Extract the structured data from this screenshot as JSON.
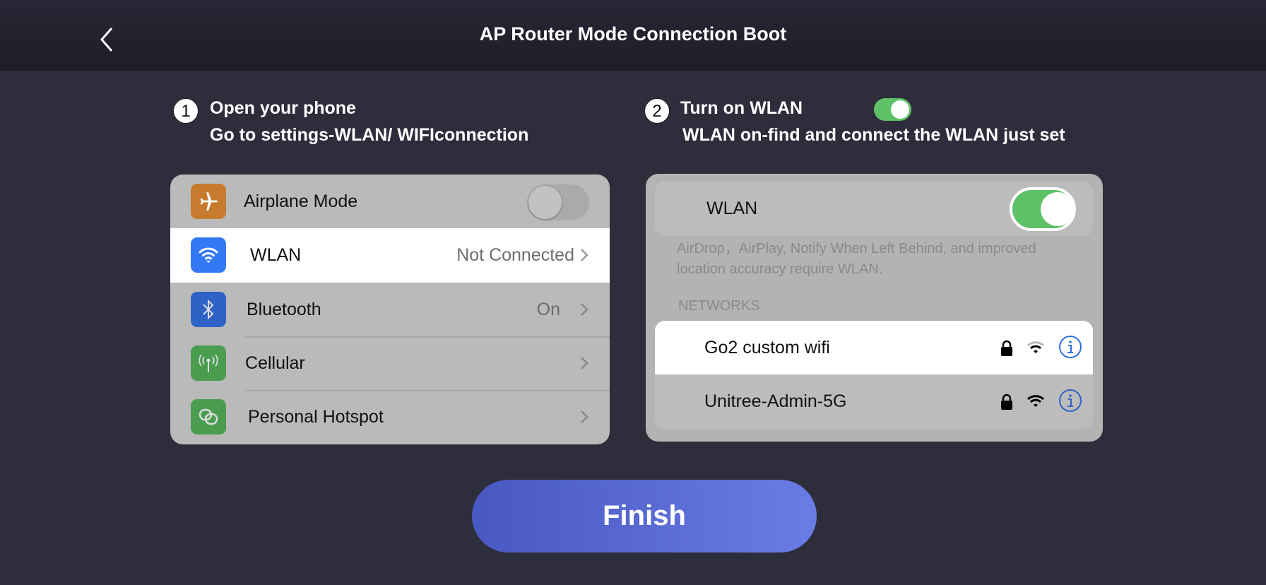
{
  "header": {
    "title": "AP Router Mode Connection Boot",
    "back_icon": "chevron-left-icon"
  },
  "step1": {
    "number": "1",
    "line1": "Open your phone",
    "line2": "Go to settings-WLAN/ WIFIconnection"
  },
  "step2": {
    "number": "2",
    "line1": "Turn on WLAN",
    "line2": "WLAN on-find and connect the WLAN just set",
    "toggle_on": true
  },
  "settings": {
    "items": [
      {
        "label": "Airplane Mode",
        "icon": "airplane-icon",
        "color": "#c77b2e",
        "toggle_on": false
      },
      {
        "label": "WLAN",
        "value": "Not Connected",
        "icon": "wifi-icon",
        "color": "#3478f6",
        "highlighted": true
      },
      {
        "label": "Bluetooth",
        "value": "On",
        "icon": "bluetooth-icon",
        "color": "#2f62c6"
      },
      {
        "label": "Cellular",
        "icon": "antenna-icon",
        "color": "#4a9d4f"
      },
      {
        "label": "Personal Hotspot",
        "icon": "hotspot-icon",
        "color": "#4a9d4f"
      }
    ]
  },
  "wlan": {
    "label": "WLAN",
    "toggle_on": true,
    "note": "AirDrop，AirPlay, Notify When Left Behind, and improved location accuracy require WLAN.",
    "networks_header": "NETWORKS",
    "networks": [
      {
        "name": "Go2 custom wifi",
        "highlighted": true
      },
      {
        "name": "Unitree-Admin-5G"
      }
    ]
  },
  "finish_label": "Finish",
  "colors": {
    "accent": "#5a6bd6",
    "toggle_green": "#5fc167",
    "background": "#2e2d3c"
  }
}
